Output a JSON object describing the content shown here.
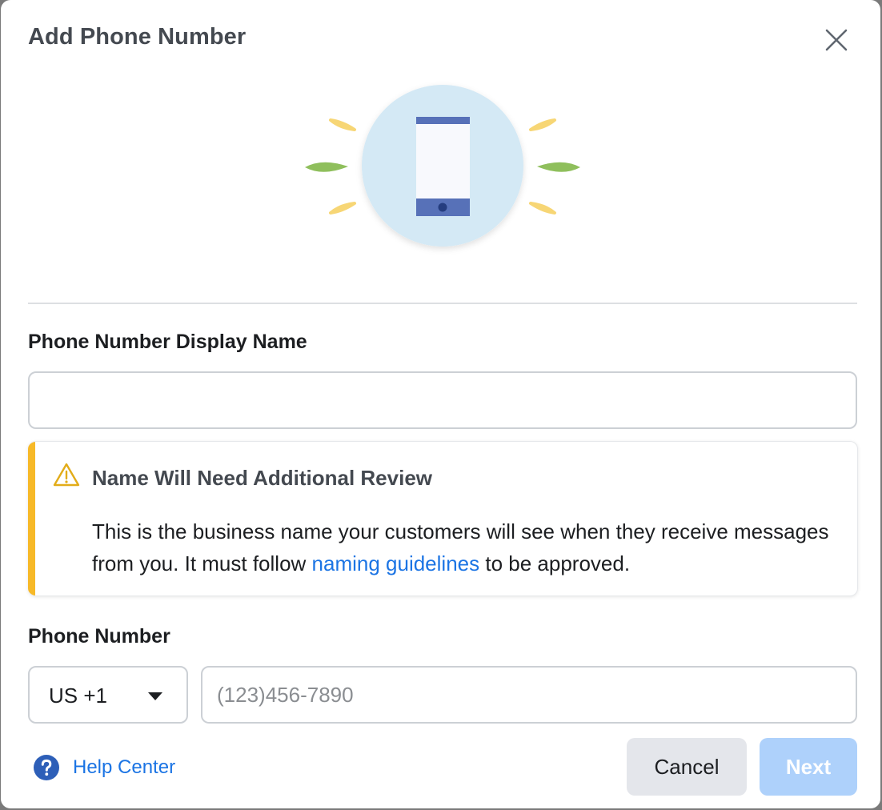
{
  "dialog": {
    "title": "Add Phone Number",
    "close_icon": "close-icon"
  },
  "illustration": {
    "icon": "smartphone-icon"
  },
  "display_name": {
    "label": "Phone Number Display Name",
    "value": "",
    "placeholder": ""
  },
  "warning": {
    "icon": "warning-triangle-icon",
    "title": "Name Will Need Additional Review",
    "body_before": "This is the business name your customers will see when they receive messages from you. It must follow ",
    "link_text": "naming guidelines",
    "body_after": " to be approved.",
    "accent_color": "#f7b928"
  },
  "phone": {
    "label": "Phone Number",
    "country_code": "US +1",
    "placeholder": "(123)456-7890",
    "value": ""
  },
  "footer": {
    "help_icon": "question-circle-icon",
    "help_text": "Help Center",
    "cancel_label": "Cancel",
    "next_label": "Next",
    "next_enabled": false
  },
  "colors": {
    "link": "#1b74e4",
    "primary_disabled": "#aed1fb"
  }
}
